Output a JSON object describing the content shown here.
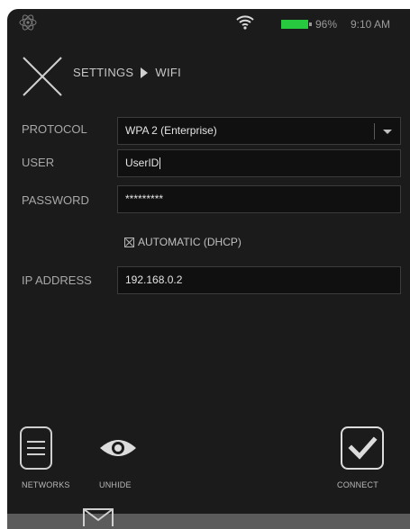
{
  "status_bar": {
    "battery_percent": "96%",
    "time": "9:10 AM",
    "battery_color": "#27c93f"
  },
  "header": {
    "crumb_parent": "SETTINGS",
    "crumb_current": "WIFI",
    "close_icon": "close-x-icon"
  },
  "form": {
    "protocol_label": "PROTOCOL",
    "protocol_value": "WPA 2 (Enterprise)",
    "user_label": "USER",
    "user_value": "UserID",
    "password_label": "PASSWORD",
    "password_value": "*********",
    "dhcp_label": "AUTOMATIC (DHCP)",
    "dhcp_checked": true,
    "ip_label": "IP ADDRESS",
    "ip_value": "192.168.0.2"
  },
  "toolbar": {
    "networks_label": "NETWORKS",
    "unhide_label": "UNHIDE",
    "connect_label": "CONNECT"
  }
}
